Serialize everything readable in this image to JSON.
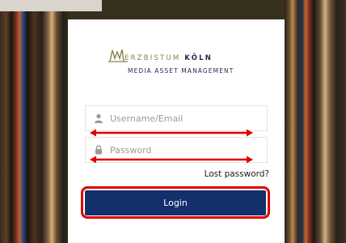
{
  "logo": {
    "brand_prefix": "ERZBISTUM",
    "brand_suffix": "KÖLN",
    "subtitle": "MEDIA ASSET MANAGEMENT"
  },
  "form": {
    "username_placeholder": "Username/Email",
    "password_placeholder": "Password",
    "lost_password": "Lost password?",
    "login_label": "Login"
  },
  "icons": {
    "username": "user-icon",
    "password": "lock-icon"
  },
  "colors": {
    "button": "#13306a",
    "annotation": "#e00000",
    "logo_gold": "#8a8448"
  }
}
